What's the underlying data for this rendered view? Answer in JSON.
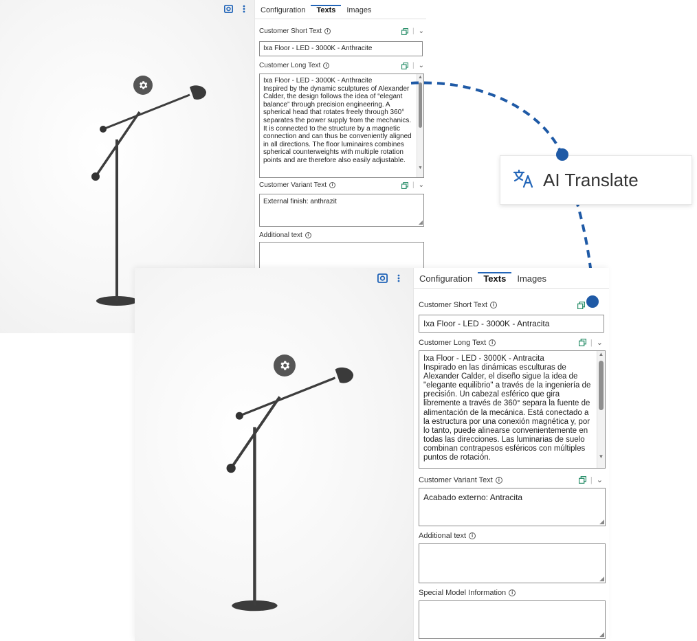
{
  "colors": {
    "accent": "#2265b8",
    "connector": "#1f5aa6",
    "copy_icon": "#2a8f6a"
  },
  "callout": {
    "label": "AI Translate",
    "icon": "translate-icon"
  },
  "windows": {
    "english": {
      "tabs": [
        "Configuration",
        "Texts",
        "Images"
      ],
      "fields": {
        "short_text": {
          "label": "Customer Short Text",
          "value": "Ixa Floor - LED - 3000K - Anthracite"
        },
        "long_text": {
          "label": "Customer Long Text",
          "value": "Ixa Floor - LED - 3000K - Anthracite\nInspired by the dynamic sculptures of Alexander Calder, the design follows the idea of “elegant balance” through precision engineering. A spherical head that rotates freely through 360° separates the power supply from the mechanics. It is connected to the structure by a magnetic connection and can thus be conveniently aligned in all directions. The floor luminaires combines spherical counterweights with multiple rotation points and are therefore also easily adjustable."
        },
        "variant_text": {
          "label": "Customer Variant Text",
          "value": "External finish: anthrazit"
        },
        "additional_text": {
          "label": "Additional text",
          "value": ""
        }
      }
    },
    "spanish": {
      "tabs": [
        "Configuration",
        "Texts",
        "Images"
      ],
      "fields": {
        "short_text": {
          "label": "Customer Short Text",
          "value": "Ixa Floor - LED - 3000K - Antracita"
        },
        "long_text": {
          "label": "Customer Long Text",
          "value": "Ixa Floor - LED - 3000K - Antracita\nInspirado en las dinámicas esculturas de Alexander Calder, el diseño sigue la idea de \"elegante equilibrio\" a través de la ingeniería de precisión. Un cabezal esférico que gira libremente a través de 360° separa la fuente de alimentación de la mecánica. Está conectado a la estructura por una conexión magnética y, por lo tanto, puede alinearse convenientemente en todas las direcciones. Las luminarias de suelo combinan contrapesos esféricos con múltiples puntos de rotación."
        },
        "variant_text": {
          "label": "Customer Variant Text",
          "value": "Acabado externo: Antracita"
        },
        "additional_text": {
          "label": "Additional text",
          "value": ""
        },
        "special_model": {
          "label": "Special Model Information",
          "value": ""
        }
      }
    }
  }
}
